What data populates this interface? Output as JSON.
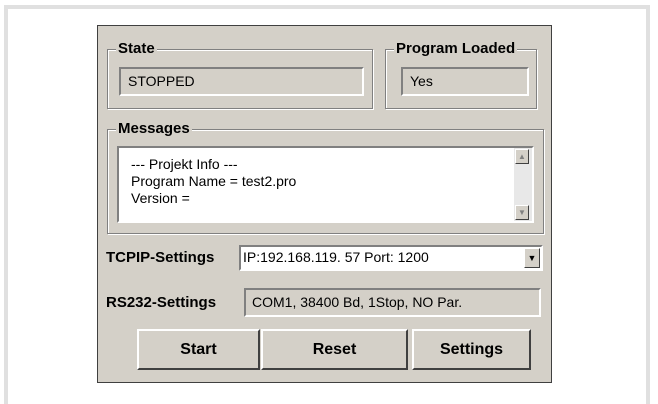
{
  "state": {
    "title": "State",
    "value": "STOPPED"
  },
  "program_loaded": {
    "title": "Program Loaded",
    "value": "Yes"
  },
  "messages": {
    "title": "Messages",
    "lines": [
      "--- Projekt Info ---",
      "Program Name = test2.pro",
      "Version ="
    ]
  },
  "tcpip": {
    "label": "TCPIP-Settings",
    "value": "IP:192.168.119.  57  Port: 1200"
  },
  "rs232": {
    "label": "RS232-Settings",
    "value": "COM1, 38400 Bd, 1Stop, NO Par."
  },
  "buttons": {
    "start": "Start",
    "reset": "Reset",
    "settings": "Settings"
  },
  "icons": {
    "scroll_up": "scroll-up-arrow",
    "scroll_down": "scroll-down-arrow",
    "dropdown": "dropdown-arrow"
  }
}
